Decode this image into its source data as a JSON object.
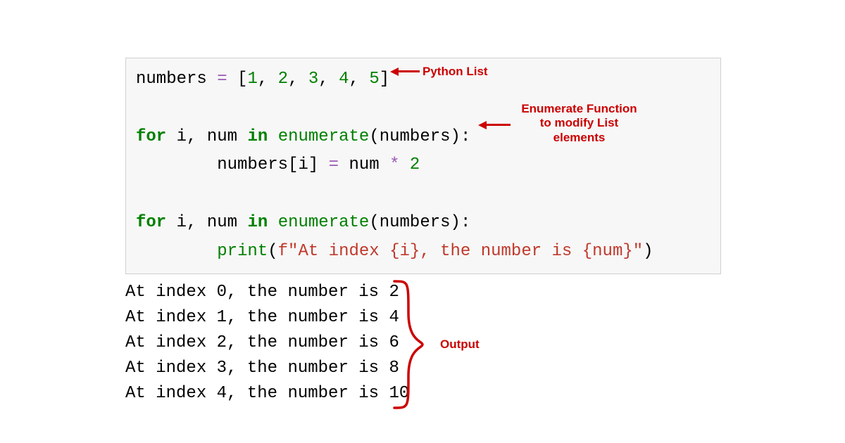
{
  "code": {
    "line1": {
      "var": "numbers",
      "assign": " = ",
      "lbracket": "[",
      "n1": "1",
      "c1": ", ",
      "n2": "2",
      "c2": ", ",
      "n3": "3",
      "c3": ", ",
      "n4": "4",
      "c4": ", ",
      "n5": "5",
      "rbracket": "]"
    },
    "line3": {
      "kw_for": "for",
      "sp1": " ",
      "i": "i",
      "c": ", ",
      "num": "num",
      "sp2": " ",
      "kw_in": "in",
      "sp3": " ",
      "fn": "enumerate",
      "lp": "(",
      "arg": "numbers",
      "rp": ")",
      "colon": ":"
    },
    "line4": {
      "indent": "        ",
      "lhs": "numbers",
      "lb": "[",
      "idx": "i",
      "rb": "]",
      "eq": " = ",
      "rhs1": "num",
      "sp": " ",
      "op": "*",
      "sp2": " ",
      "two": "2"
    },
    "line6": {
      "kw_for": "for",
      "sp1": " ",
      "i": "i",
      "c": ", ",
      "num": "num",
      "sp2": " ",
      "kw_in": "in",
      "sp3": " ",
      "fn": "enumerate",
      "lp": "(",
      "arg": "numbers",
      "rp": ")",
      "colon": ":"
    },
    "line7": {
      "indent": "        ",
      "fn": "print",
      "lp": "(",
      "fpre": "f",
      "q1": "\"",
      "s1": "At index ",
      "lb1": "{i}",
      "s2": ", the number is ",
      "lb2": "{num}",
      "q2": "\"",
      "rp": ")"
    }
  },
  "output": {
    "l1": "At index 0, the number is 2",
    "l2": "At index 1, the number is 4",
    "l3": "At index 2, the number is 6",
    "l4": "At index 3, the number is 8",
    "l5": "At index 4, the number is 10"
  },
  "annotations": {
    "a1": "Python List",
    "a2_l1": "Enumerate Function",
    "a2_l2": "to modify List",
    "a2_l3": "elements",
    "a3": "Output"
  }
}
